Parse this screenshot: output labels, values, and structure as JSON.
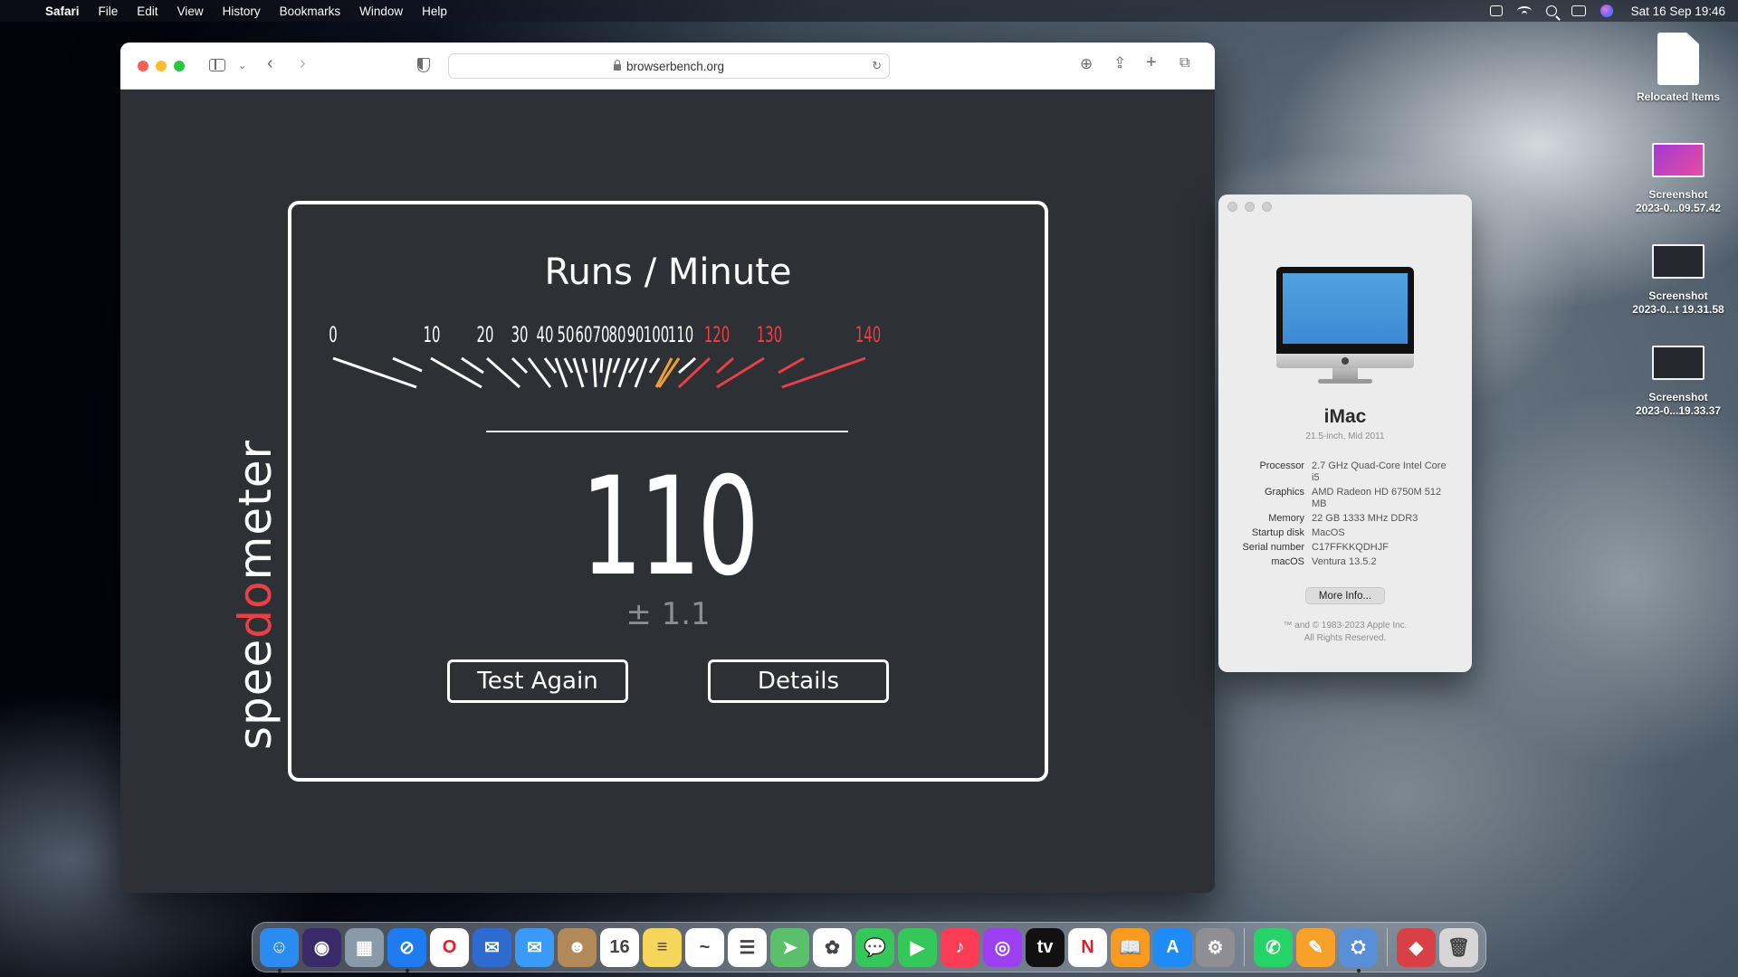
{
  "menubar": {
    "app_name": "Safari",
    "menus": [
      "File",
      "Edit",
      "View",
      "History",
      "Bookmarks",
      "Window",
      "Help"
    ],
    "clock": "Sat 16 Sep  19:46"
  },
  "safari": {
    "url": "browserbench.org"
  },
  "speedometer": {
    "brand_pre": "spee",
    "brand_red": "do",
    "brand_post": "meter",
    "title": "Runs / Minute",
    "score": "110",
    "error": "± 1.1",
    "test_again_label": "Test Again",
    "details_label": "Details",
    "gauge_labels_white": [
      "0",
      "10",
      "20",
      "30",
      "40",
      "50",
      "60",
      "70",
      "80",
      "90",
      "100",
      "110"
    ],
    "gauge_labels_red": [
      "120",
      "130",
      "140"
    ],
    "needle_value": 110,
    "accent_red": "#e84045",
    "needle_color": "#f0a030"
  },
  "about": {
    "model": "iMac",
    "model_sub": "21.5-inch, Mid 2011",
    "specs": [
      {
        "key": "Processor",
        "value": "2.7 GHz Quad-Core Intel Core i5"
      },
      {
        "key": "Graphics",
        "value": "AMD Radeon HD 6750M 512 MB"
      },
      {
        "key": "Memory",
        "value": "22 GB 1333 MHz DDR3"
      },
      {
        "key": "Startup disk",
        "value": "MacOS"
      },
      {
        "key": "Serial number",
        "value": "C17FFKKQDHJF"
      },
      {
        "key": "macOS",
        "value": "Ventura 13.5.2"
      }
    ],
    "more_info_label": "More Info...",
    "legal_1": "™ and © 1983-2023 Apple Inc.",
    "legal_2": "All Rights Reserved."
  },
  "desktop_icons": [
    {
      "label1": "Relocated Items",
      "label2": ""
    },
    {
      "label1": "Screenshot",
      "label2": "2023-0...09.57.42"
    },
    {
      "label1": "Screenshot",
      "label2": "2023-0...t 19.31.58"
    },
    {
      "label1": "Screenshot",
      "label2": "2023-0...19.33.37"
    }
  ],
  "dock": {
    "apps": [
      {
        "name": "finder-icon",
        "color": "#2a8cf0",
        "glyph": "☺"
      },
      {
        "name": "siri-icon",
        "color": "#3a2a6a",
        "glyph": "◉"
      },
      {
        "name": "launchpad-icon",
        "color": "#8a9aa8",
        "glyph": "▦"
      },
      {
        "name": "safari-icon",
        "color": "#1e7cf0",
        "glyph": "⊘"
      },
      {
        "name": "opera-icon",
        "color": "#ffffff",
        "glyph": "O"
      },
      {
        "name": "thunderbird-icon",
        "color": "#2f6ad1",
        "glyph": "✉"
      },
      {
        "name": "mail-icon",
        "color": "#3a9af5",
        "glyph": "✉"
      },
      {
        "name": "contacts-icon",
        "color": "#b28a5a",
        "glyph": "☻"
      },
      {
        "name": "calendar-icon",
        "color": "#ffffff",
        "glyph": "16"
      },
      {
        "name": "notes-icon",
        "color": "#f6d65a",
        "glyph": "≡"
      },
      {
        "name": "freeform-icon",
        "color": "#ffffff",
        "glyph": "~"
      },
      {
        "name": "reminders-icon",
        "color": "#ffffff",
        "glyph": "☰"
      },
      {
        "name": "maps-icon",
        "color": "#5ac16a",
        "glyph": "➤"
      },
      {
        "name": "photos-icon",
        "color": "#ffffff",
        "glyph": "✿"
      },
      {
        "name": "messages-icon",
        "color": "#35c759",
        "glyph": "💬"
      },
      {
        "name": "facetime-icon",
        "color": "#35c759",
        "glyph": "▶"
      },
      {
        "name": "music-icon",
        "color": "#fb3c54",
        "glyph": "♪"
      },
      {
        "name": "podcasts-icon",
        "color": "#9c3ff0",
        "glyph": "◎"
      },
      {
        "name": "appletv-icon",
        "color": "#111111",
        "glyph": "tv"
      },
      {
        "name": "news-icon",
        "color": "#ffffff",
        "glyph": "N"
      },
      {
        "name": "books-icon",
        "color": "#f79a1e",
        "glyph": "📖"
      },
      {
        "name": "appstore-icon",
        "color": "#1f8cf6",
        "glyph": "A"
      },
      {
        "name": "system-settings-icon",
        "color": "#8e8e93",
        "glyph": "⚙"
      },
      {
        "name": "whatsapp-icon",
        "color": "#25d366",
        "glyph": "✆"
      },
      {
        "name": "pages-icon",
        "color": "#f7a12a",
        "glyph": "✎"
      },
      {
        "name": "disk-utility-icon",
        "color": "#5a8ed6",
        "glyph": "⛭"
      },
      {
        "name": "app-folder-icon",
        "color": "#d84045",
        "glyph": "◆"
      },
      {
        "name": "trash-icon",
        "color": "#d6d6d6",
        "glyph": "🗑"
      }
    ]
  }
}
